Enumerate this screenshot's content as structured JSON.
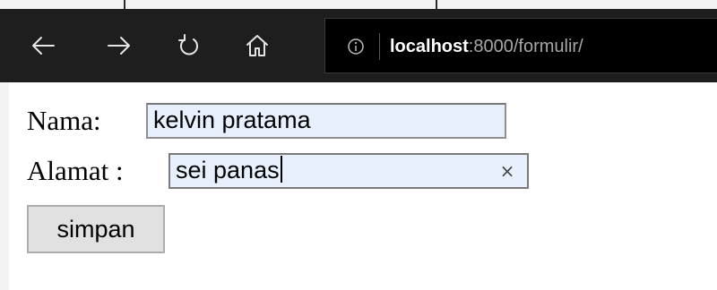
{
  "browser": {
    "nav": {
      "back_icon": "arrow-left-icon",
      "forward_icon": "arrow-right-icon",
      "refresh_icon": "refresh-icon",
      "home_icon": "home-icon"
    },
    "address": {
      "info_icon": "info-icon",
      "host": "localhost",
      "rest": ":8000/formulir/"
    },
    "colors": {
      "toolbar": "#1e1e1e",
      "address_bg": "#000000",
      "host_text": "#ffffff",
      "path_text": "#a8a8a8"
    }
  },
  "form": {
    "nama_label": "Nama:",
    "nama_value": "kelvin pratama",
    "alamat_label": "Alamat :",
    "alamat_value": "sei panas",
    "clear_glyph": "×",
    "submit_label": "simpan",
    "colors": {
      "input_bg": "#e8f0fe",
      "button_bg": "#e1e1e1"
    }
  }
}
